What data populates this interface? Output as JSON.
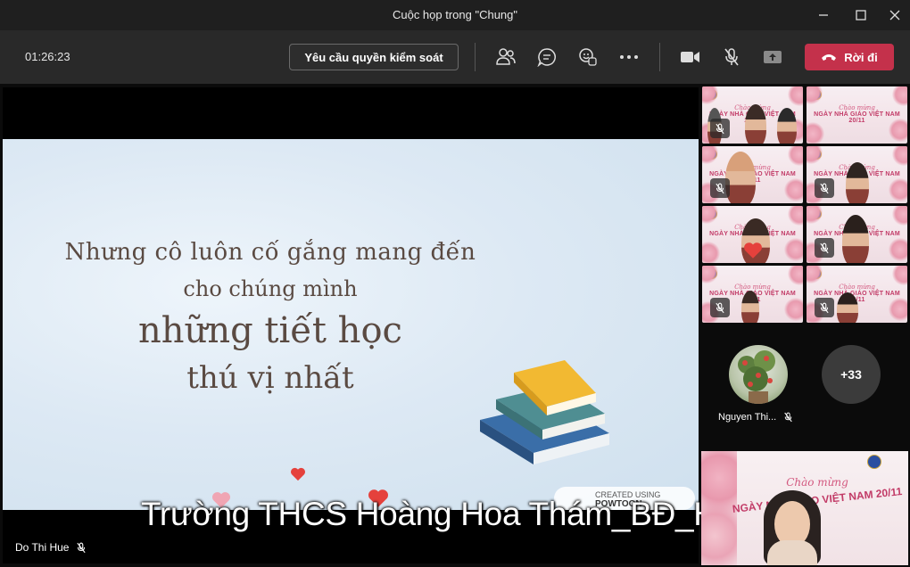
{
  "window": {
    "title": "Cuộc họp trong \"Chung\"",
    "minimize_icon": "minimize-icon",
    "maximize_icon": "maximize-icon",
    "close_icon": "close-icon"
  },
  "toolbar": {
    "timer": "01:26:23",
    "request_control_label": "Yêu cầu quyền kiểm soát",
    "icons": [
      "people-icon",
      "chat-icon",
      "reactions-icon",
      "more-icon",
      "camera-icon",
      "mic-muted-icon",
      "share-tray-icon"
    ],
    "leave_label": "Rời đi",
    "leave_color": "#c4314b"
  },
  "stage": {
    "slide_lines": [
      "Nhưng cô luôn cố gắng mang đến",
      "cho chúng mình",
      "những tiết học",
      "thú vị nhất"
    ],
    "watermark": "CREATED USING",
    "watermark_brand": "POWTOON",
    "caption": "Trường THCS Hoàng Hoa Thám_BĐ_HN",
    "presenter_name": "Do Thi Hue"
  },
  "gallery": {
    "tile_line1": "Chào mừng",
    "tile_line2": "NGÀY NHÀ GIÁO VIỆT NAM 20/11",
    "extra_participant_name": "Nguyen Thi...",
    "overflow_count": "+33"
  },
  "selfview": {
    "line1": "Chào mừng",
    "line2": "NGÀY NHÀ GIÁO VIỆT NAM 20/11"
  }
}
